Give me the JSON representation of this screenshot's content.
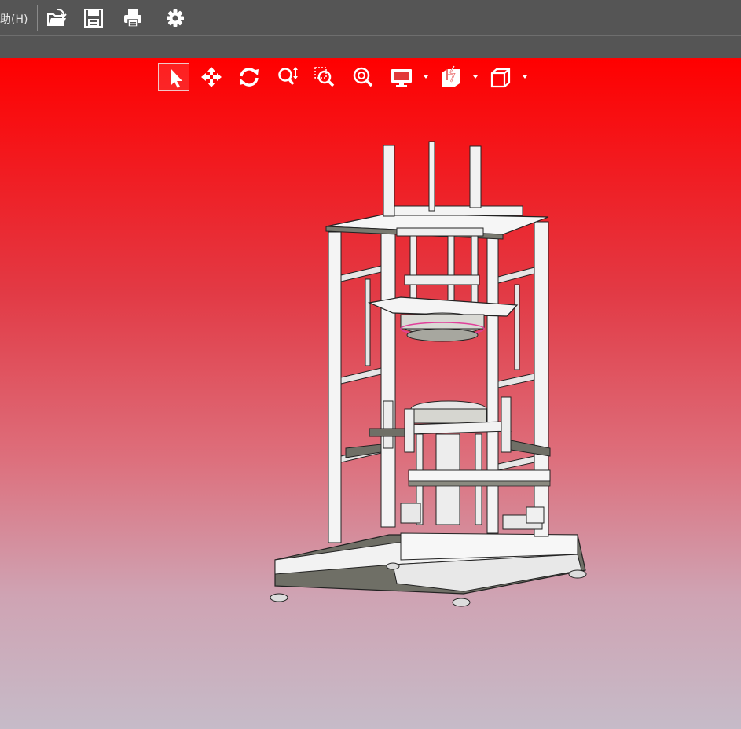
{
  "menubar": {
    "help_menu_label": "助(H)",
    "icons": [
      "open-folder-icon",
      "save-icon",
      "print-icon",
      "gear-icon"
    ]
  },
  "viewer": {
    "toolbar_icons": [
      "select-arrow-icon",
      "pan-move-icon",
      "rotate-icon",
      "zoom-icon",
      "zoom-window-icon",
      "zoom-fit-icon",
      "display-mode-icon",
      "section-view-icon",
      "view-cube-icon"
    ],
    "active_tool": "select-arrow-icon"
  },
  "colors": {
    "menubar_bg": "#555555",
    "viewport_top": "#ff0000",
    "viewport_bottom": "#c6bbc8",
    "model_body": "#f2f2f2",
    "model_shadow": "#6f6f66"
  }
}
